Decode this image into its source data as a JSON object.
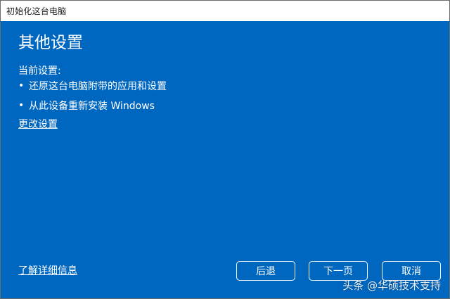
{
  "window": {
    "title": "初始化这台电脑"
  },
  "main": {
    "heading": "其他设置",
    "current_settings_label": "当前设置:",
    "bullets": [
      "还原这台电脑附带的应用和设置",
      "从此设备重新安装 Windows"
    ],
    "bullet_char": "•",
    "change_settings_link": "更改设置",
    "learn_more_link": "了解详细信息"
  },
  "buttons": {
    "back": "后退",
    "next": "下一页",
    "cancel": "取消"
  },
  "watermark": "头条 @华硕技术支持",
  "colors": {
    "background": "#0067c0",
    "titlebar": "#ffffff",
    "text": "#ffffff"
  }
}
